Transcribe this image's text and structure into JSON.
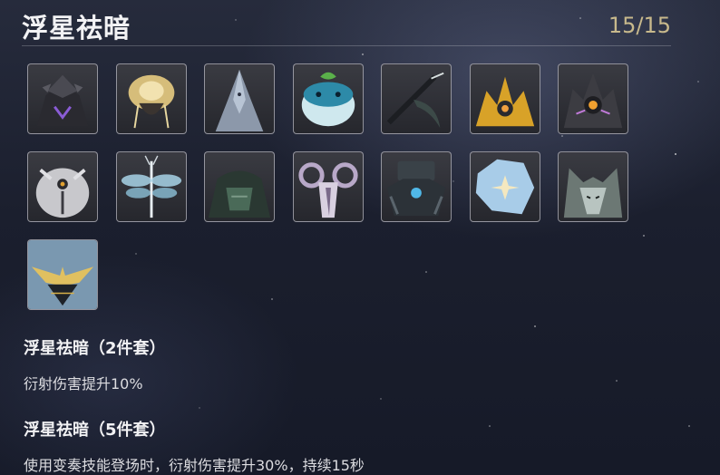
{
  "header": {
    "title": "浮星祛暗",
    "count": "15/15"
  },
  "echoes": [
    {
      "icon": "dark-flower-knight-icon",
      "accent": "#8a5cd6"
    },
    {
      "icon": "golden-rose-icon",
      "accent": "#e0c070"
    },
    {
      "icon": "steel-spire-icon",
      "accent": "#9aa6b8"
    },
    {
      "icon": "leaf-puffer-icon",
      "accent": "#4fb0c8"
    },
    {
      "icon": "black-scythe-icon",
      "accent": "#6c8c7c"
    },
    {
      "icon": "golden-crystal-beast-icon",
      "accent": "#e0a830"
    },
    {
      "icon": "violet-crystal-beast-icon",
      "accent": "#c07ad8"
    },
    {
      "icon": "white-owl-icon",
      "accent": "#e0a030"
    },
    {
      "icon": "dragonfly-icon",
      "accent": "#8cc8e0"
    },
    {
      "icon": "stone-golem-icon",
      "accent": "#4f7060"
    },
    {
      "icon": "horned-ram-icon",
      "accent": "#c8b0d8"
    },
    {
      "icon": "mech-crab-icon",
      "accent": "#50b8e8"
    },
    {
      "icon": "ice-flower-icon",
      "accent": "#a8d0f0"
    },
    {
      "icon": "pale-wolf-icon",
      "accent": "#b8c4c0"
    },
    {
      "icon": "winged-dragon-icon",
      "accent": "#d8b048"
    }
  ],
  "bonuses": [
    {
      "title": "浮星祛暗（2件套）",
      "desc": "衍射伤害提升10%"
    },
    {
      "title": "浮星祛暗（5件套）",
      "desc": "使用变奏技能登场时，衍射伤害提升30%，持续15秒"
    }
  ]
}
